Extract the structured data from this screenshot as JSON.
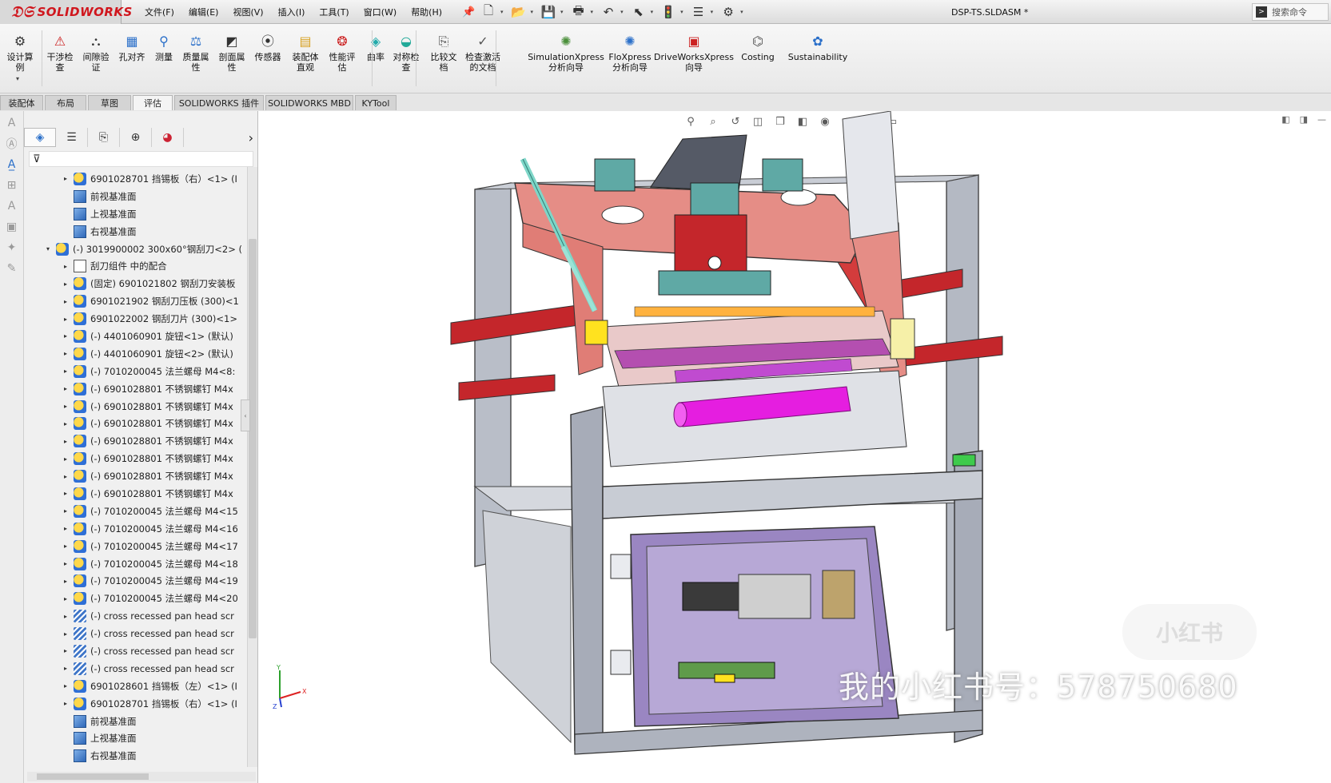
{
  "app": {
    "brand": "SOLIDWORKS",
    "document_title": "DSP-TS.SLDASM *",
    "search_placeholder": "搜索命令"
  },
  "menu": [
    "文件(F)",
    "编辑(E)",
    "视图(V)",
    "插入(I)",
    "工具(T)",
    "窗口(W)",
    "帮助(H)"
  ],
  "quick_icons": [
    "new-icon",
    "open-icon",
    "save-icon",
    "print-icon",
    "undo-icon",
    "select-icon",
    "rebuild-icon",
    "file-properties-icon",
    "options-icon"
  ],
  "ribbon": [
    {
      "label": "设计算\n例",
      "icon": "design-study-icon"
    },
    {
      "label": "干涉检\n查",
      "icon": "interference-icon"
    },
    {
      "label": "间隙验\n证",
      "icon": "clearance-icon"
    },
    {
      "label": "孔对齐",
      "icon": "hole-align-icon"
    },
    {
      "label": "测量",
      "icon": "measure-icon"
    },
    {
      "label": "质量属\n性",
      "icon": "mass-properties-icon"
    },
    {
      "label": "剖面属\n性",
      "icon": "section-properties-icon"
    },
    {
      "label": "传感器",
      "icon": "sensor-icon"
    },
    {
      "label": "装配体\n直观",
      "icon": "assembly-visualization-icon"
    },
    {
      "label": "性能评\n估",
      "icon": "performance-icon"
    },
    {
      "label": "曲率",
      "icon": "curvature-icon"
    },
    {
      "label": "对称检\n查",
      "icon": "symmetry-icon"
    },
    {
      "label": "比较文\n档",
      "icon": "compare-icon"
    },
    {
      "label": "检查激活\n的文档",
      "icon": "check-active-icon"
    },
    {
      "label": "SimulationXpress\n分析向导",
      "icon": "simulationxpress-icon"
    },
    {
      "label": "FloXpress\n分析向导",
      "icon": "floxpress-icon"
    },
    {
      "label": "DriveWorksXpress\n向导",
      "icon": "driveworks-icon"
    },
    {
      "label": "Costing",
      "icon": "costing-icon"
    },
    {
      "label": "Sustainability",
      "icon": "sustainability-icon"
    }
  ],
  "tabs": [
    {
      "label": "装配体",
      "active": false
    },
    {
      "label": "布局",
      "active": false
    },
    {
      "label": "草图",
      "active": false
    },
    {
      "label": "评估",
      "active": true
    },
    {
      "label": "SOLIDWORKS 插件",
      "active": false
    },
    {
      "label": "SOLIDWORKS MBD",
      "active": false
    },
    {
      "label": "KYTool",
      "active": false
    }
  ],
  "feature_manager": {
    "tabs": [
      "feature-tree-icon",
      "property-manager-icon",
      "config-manager-icon",
      "dimxpert-icon",
      "display-manager-icon"
    ],
    "tree": [
      {
        "label": "6901028701 挡锡板（右）<1> (I",
        "icon": "part",
        "level": 1,
        "toggle": "▸"
      },
      {
        "label": "前视基准面",
        "icon": "plane",
        "level": 1,
        "toggle": ""
      },
      {
        "label": "上视基准面",
        "icon": "plane",
        "level": 1,
        "toggle": ""
      },
      {
        "label": "右视基准面",
        "icon": "plane",
        "level": 1,
        "toggle": ""
      },
      {
        "label": "(-) 3019900002 300x60°钢刮刀<2> (",
        "icon": "part",
        "level": 0,
        "toggle": "▾"
      },
      {
        "label": "刮刀组件 中的配合",
        "icon": "mate",
        "level": 1,
        "toggle": "▸"
      },
      {
        "label": "(固定) 6901021802 钢刮刀安装板",
        "icon": "part",
        "level": 1,
        "toggle": "▸"
      },
      {
        "label": "6901021902 钢刮刀压板 (300)<1",
        "icon": "part",
        "level": 1,
        "toggle": "▸"
      },
      {
        "label": "6901022002 钢刮刀片 (300)<1>",
        "icon": "part",
        "level": 1,
        "toggle": "▸"
      },
      {
        "label": "(-) 4401060901 旋钮<1> (默认)",
        "icon": "part",
        "level": 1,
        "toggle": "▸"
      },
      {
        "label": "(-) 4401060901 旋钮<2> (默认)",
        "icon": "part",
        "level": 1,
        "toggle": "▸"
      },
      {
        "label": "(-) 7010200045 法兰螺母 M4<8:",
        "icon": "part",
        "level": 1,
        "toggle": "▸"
      },
      {
        "label": "(-) 6901028801 不锈钢螺钉 M4x",
        "icon": "part",
        "level": 1,
        "toggle": "▸"
      },
      {
        "label": "(-) 6901028801 不锈钢螺钉 M4x",
        "icon": "part",
        "level": 1,
        "toggle": "▸"
      },
      {
        "label": "(-) 6901028801 不锈钢螺钉 M4x",
        "icon": "part",
        "level": 1,
        "toggle": "▸"
      },
      {
        "label": "(-) 6901028801 不锈钢螺钉 M4x",
        "icon": "part",
        "level": 1,
        "toggle": "▸"
      },
      {
        "label": "(-) 6901028801 不锈钢螺钉 M4x",
        "icon": "part",
        "level": 1,
        "toggle": "▸"
      },
      {
        "label": "(-) 6901028801 不锈钢螺钉 M4x",
        "icon": "part",
        "level": 1,
        "toggle": "▸"
      },
      {
        "label": "(-) 6901028801 不锈钢螺钉 M4x",
        "icon": "part",
        "level": 1,
        "toggle": "▸"
      },
      {
        "label": "(-) 7010200045 法兰螺母 M4<15",
        "icon": "part",
        "level": 1,
        "toggle": "▸"
      },
      {
        "label": "(-) 7010200045 法兰螺母 M4<16",
        "icon": "part",
        "level": 1,
        "toggle": "▸"
      },
      {
        "label": "(-) 7010200045 法兰螺母 M4<17",
        "icon": "part",
        "level": 1,
        "toggle": "▸"
      },
      {
        "label": "(-) 7010200045 法兰螺母 M4<18",
        "icon": "part",
        "level": 1,
        "toggle": "▸"
      },
      {
        "label": "(-) 7010200045 法兰螺母 M4<19",
        "icon": "part",
        "level": 1,
        "toggle": "▸"
      },
      {
        "label": "(-) 7010200045 法兰螺母 M4<20",
        "icon": "part",
        "level": 1,
        "toggle": "▸"
      },
      {
        "label": "(-) cross recessed pan head scr",
        "icon": "screw",
        "level": 1,
        "toggle": "▸"
      },
      {
        "label": "(-) cross recessed pan head scr",
        "icon": "screw",
        "level": 1,
        "toggle": "▸"
      },
      {
        "label": "(-) cross recessed pan head scr",
        "icon": "screw",
        "level": 1,
        "toggle": "▸"
      },
      {
        "label": "(-) cross recessed pan head scr",
        "icon": "screw",
        "level": 1,
        "toggle": "▸"
      },
      {
        "label": "6901028601 挡锡板（左）<1> (I",
        "icon": "part",
        "level": 1,
        "toggle": "▸"
      },
      {
        "label": "6901028701 挡锡板（右）<1> (I",
        "icon": "part",
        "level": 1,
        "toggle": "▸"
      },
      {
        "label": "前视基准面",
        "icon": "plane",
        "level": 1,
        "toggle": ""
      },
      {
        "label": "上视基准面",
        "icon": "plane",
        "level": 1,
        "toggle": ""
      },
      {
        "label": "右视基准面",
        "icon": "plane",
        "level": 1,
        "toggle": ""
      }
    ]
  },
  "viewport": {
    "heads_up_icons": [
      "zoom-to-fit-icon",
      "zoom-area-icon",
      "previous-view-icon",
      "section-view-icon",
      "view-orientation-icon",
      "display-style-icon",
      "hide-show-icon",
      "edit-appearance-icon",
      "apply-scene-icon",
      "view-settings-icon"
    ],
    "triad_labels": {
      "x": "X",
      "y": "Y",
      "z": "Z"
    },
    "watermark_text": "我的小红书号：578750680",
    "watermark_logo": "小红书"
  },
  "colors": {
    "accent_red": "#d0161d",
    "frame_gray": "#b7bcc6",
    "panel_purple": "#9a86c2",
    "plate_salmon": "#e58d86",
    "roller_magenta": "#e51ee0",
    "teal": "#5fa9a5",
    "rail_red": "#c4262b"
  }
}
